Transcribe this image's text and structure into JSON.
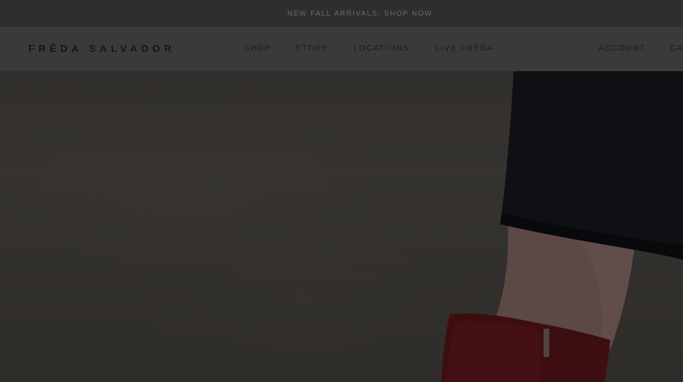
{
  "announcement": {
    "text": "NEW FALL ARRIVALS: SHOP NOW"
  },
  "header": {
    "logo": "FRĒDA SALVADOR",
    "nav": [
      "SHOP",
      "STORY",
      "LOCATIONS",
      "LIVE FREDA"
    ],
    "account_label": "ACCOUNT",
    "cart_label": "CART"
  },
  "colors": {
    "announcement_bg": "#2e2e2e",
    "header_bg": "#3a3a3a",
    "overlay": "rgba(0,0,0,0.5)",
    "boot": "#7a1c20",
    "skirt": "#1d2026"
  }
}
